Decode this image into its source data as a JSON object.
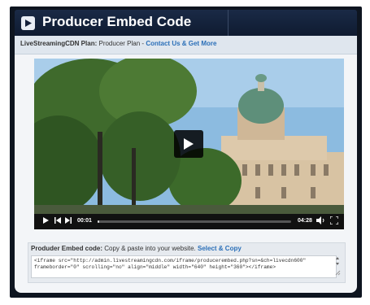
{
  "header": {
    "title": "Producer Embed Code"
  },
  "plan": {
    "label": "LiveStreamingCDN Plan:",
    "value": "Producer Plan -",
    "link": "Contact Us & Get More"
  },
  "video": {
    "current_time": "00:01",
    "duration": "04:28",
    "progress_fraction": 0.004
  },
  "embed": {
    "label": "Produder Embed code:",
    "instructions": "Copy & paste into your website.",
    "select_link": "Select & Copy",
    "code": "<iframe src=\"http://admin.livestreamingcdn.com/iframe/producerembed.php?sn=&ch=livecdn600\" frameborder=\"0\" scrolling=\"no\" align=\"middle\" width=\"640\" height=\"360\"></iframe>"
  },
  "icons": {
    "header_play": "play-icon",
    "big_play": "play-icon",
    "controls": [
      "play-icon",
      "skip-back-icon",
      "skip-forward-icon",
      "volume-icon",
      "fullscreen-icon"
    ]
  },
  "colors": {
    "header_bg": "#13203a",
    "link": "#2a6fb8",
    "frame": "#0e1520"
  }
}
